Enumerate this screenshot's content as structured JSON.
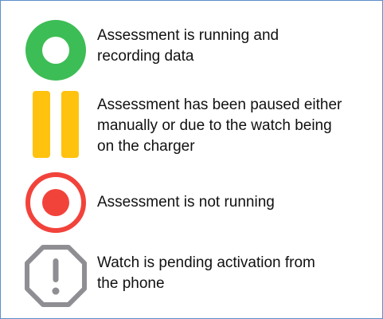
{
  "colors": {
    "border": "#5b8fc9",
    "running_green": "#3dbd55",
    "paused_yellow": "#ffc20e",
    "not_running_red": "#f2433b",
    "pending_gray": "#8e8e93"
  },
  "legend": {
    "items": [
      {
        "icon": "running-circle-icon",
        "text": "Assessment is running and\nrecording data"
      },
      {
        "icon": "pause-icon",
        "text": "Assessment has been paused either\nmanually or due to the watch being\non the charger"
      },
      {
        "icon": "record-stopped-icon",
        "text": "Assessment is not running"
      },
      {
        "icon": "exclamation-octagon-icon",
        "text": "Watch is pending activation from\nthe phone"
      }
    ]
  }
}
